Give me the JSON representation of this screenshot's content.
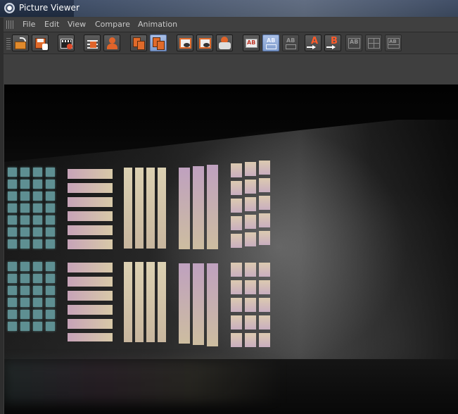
{
  "window": {
    "title": "Picture Viewer"
  },
  "menu": {
    "items": [
      "File",
      "Edit",
      "View",
      "Compare",
      "Animation"
    ]
  },
  "toolbar": {
    "buttons": [
      {
        "name": "open-image-icon",
        "active": false
      },
      {
        "name": "save-image-icon",
        "active": false
      },
      {
        "name": "render-clip-icon",
        "active": false
      },
      {
        "name": "export-frames-icon",
        "active": false
      },
      {
        "name": "render-person-icon",
        "active": false
      },
      {
        "name": "layer-stack-icon",
        "active": false
      },
      {
        "name": "layer-stack-selected-icon",
        "active": true
      },
      {
        "name": "region-view-icon",
        "active": false
      },
      {
        "name": "region-view-alt-icon",
        "active": false
      },
      {
        "name": "compare-overlay-icon",
        "active": false
      },
      {
        "name": "compare-ab-icon",
        "active": false
      },
      {
        "name": "compare-ab-split-icon",
        "active": true
      },
      {
        "name": "compare-ab-stacked-icon",
        "active": false
      },
      {
        "name": "set-a-icon",
        "active": false
      },
      {
        "name": "set-b-icon",
        "active": false
      },
      {
        "name": "swap-ab-icon",
        "active": false
      },
      {
        "name": "ab-grid-icon",
        "active": false
      },
      {
        "name": "ab-grid-alt-icon",
        "active": false
      }
    ],
    "labels": {
      "a": "A",
      "b": "B",
      "ab": "AB"
    }
  },
  "colors": {
    "accent_active": "#8fa8d8",
    "title_bar": "#243147",
    "panel": "#3b3b3b"
  }
}
